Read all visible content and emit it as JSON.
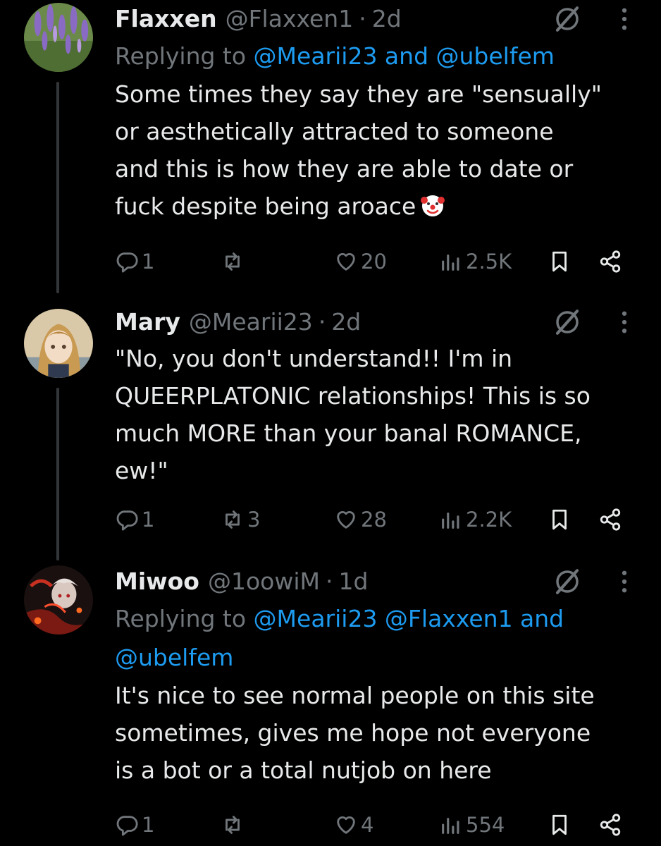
{
  "colors": {
    "background": "#000000",
    "text": "#e7e9ea",
    "secondary": "#71767b",
    "accent": "#1d9bf0",
    "thread_line": "#333639"
  },
  "tweets": [
    {
      "name": "Flaxxen",
      "handle": "@Flaxxen1",
      "separator": "·",
      "time": "2d",
      "replying_prefix": "Replying to",
      "replying_mentions": "@Mearii23 and @ubelfem",
      "body": "Some times they say they are \"sensually\"\nor aesthetically attracted to someone\nand this is how they are able to date or\nfuck despite being aroace",
      "emoji": "clown-face",
      "replies": "1",
      "reposts": "",
      "likes": "20",
      "views": "2.5K"
    },
    {
      "name": "Mary",
      "handle": "@Mearii23",
      "separator": "·",
      "time": "2d",
      "body": "\"No, you don't understand!! I'm in\nQUEERPLATONIC relationships! This is so\nmuch MORE than your banal ROMANCE,\new!\"",
      "replies": "1",
      "reposts": "3",
      "likes": "28",
      "views": "2.2K"
    },
    {
      "name": "Miwoo",
      "handle": "@1oowiM",
      "separator": "·",
      "time": "1d",
      "replying_prefix": "Replying to",
      "replying_mentions_line1": "@Mearii23 @Flaxxen1 and",
      "replying_mentions_line2": "@ubelfem",
      "body": "It's nice to see normal people on this site\nsometimes, gives me hope not everyone\nis a bot or a total nutjob on here",
      "replies": "1",
      "reposts": "",
      "likes": "4",
      "views": "554"
    }
  ],
  "icons": {
    "reply": "reply-icon",
    "repost": "repost-icon",
    "like": "heart-icon",
    "views": "views-icon",
    "bookmark": "bookmark-icon",
    "share": "share-icon",
    "grok": "grok-icon",
    "more": "more-vertical-icon"
  }
}
